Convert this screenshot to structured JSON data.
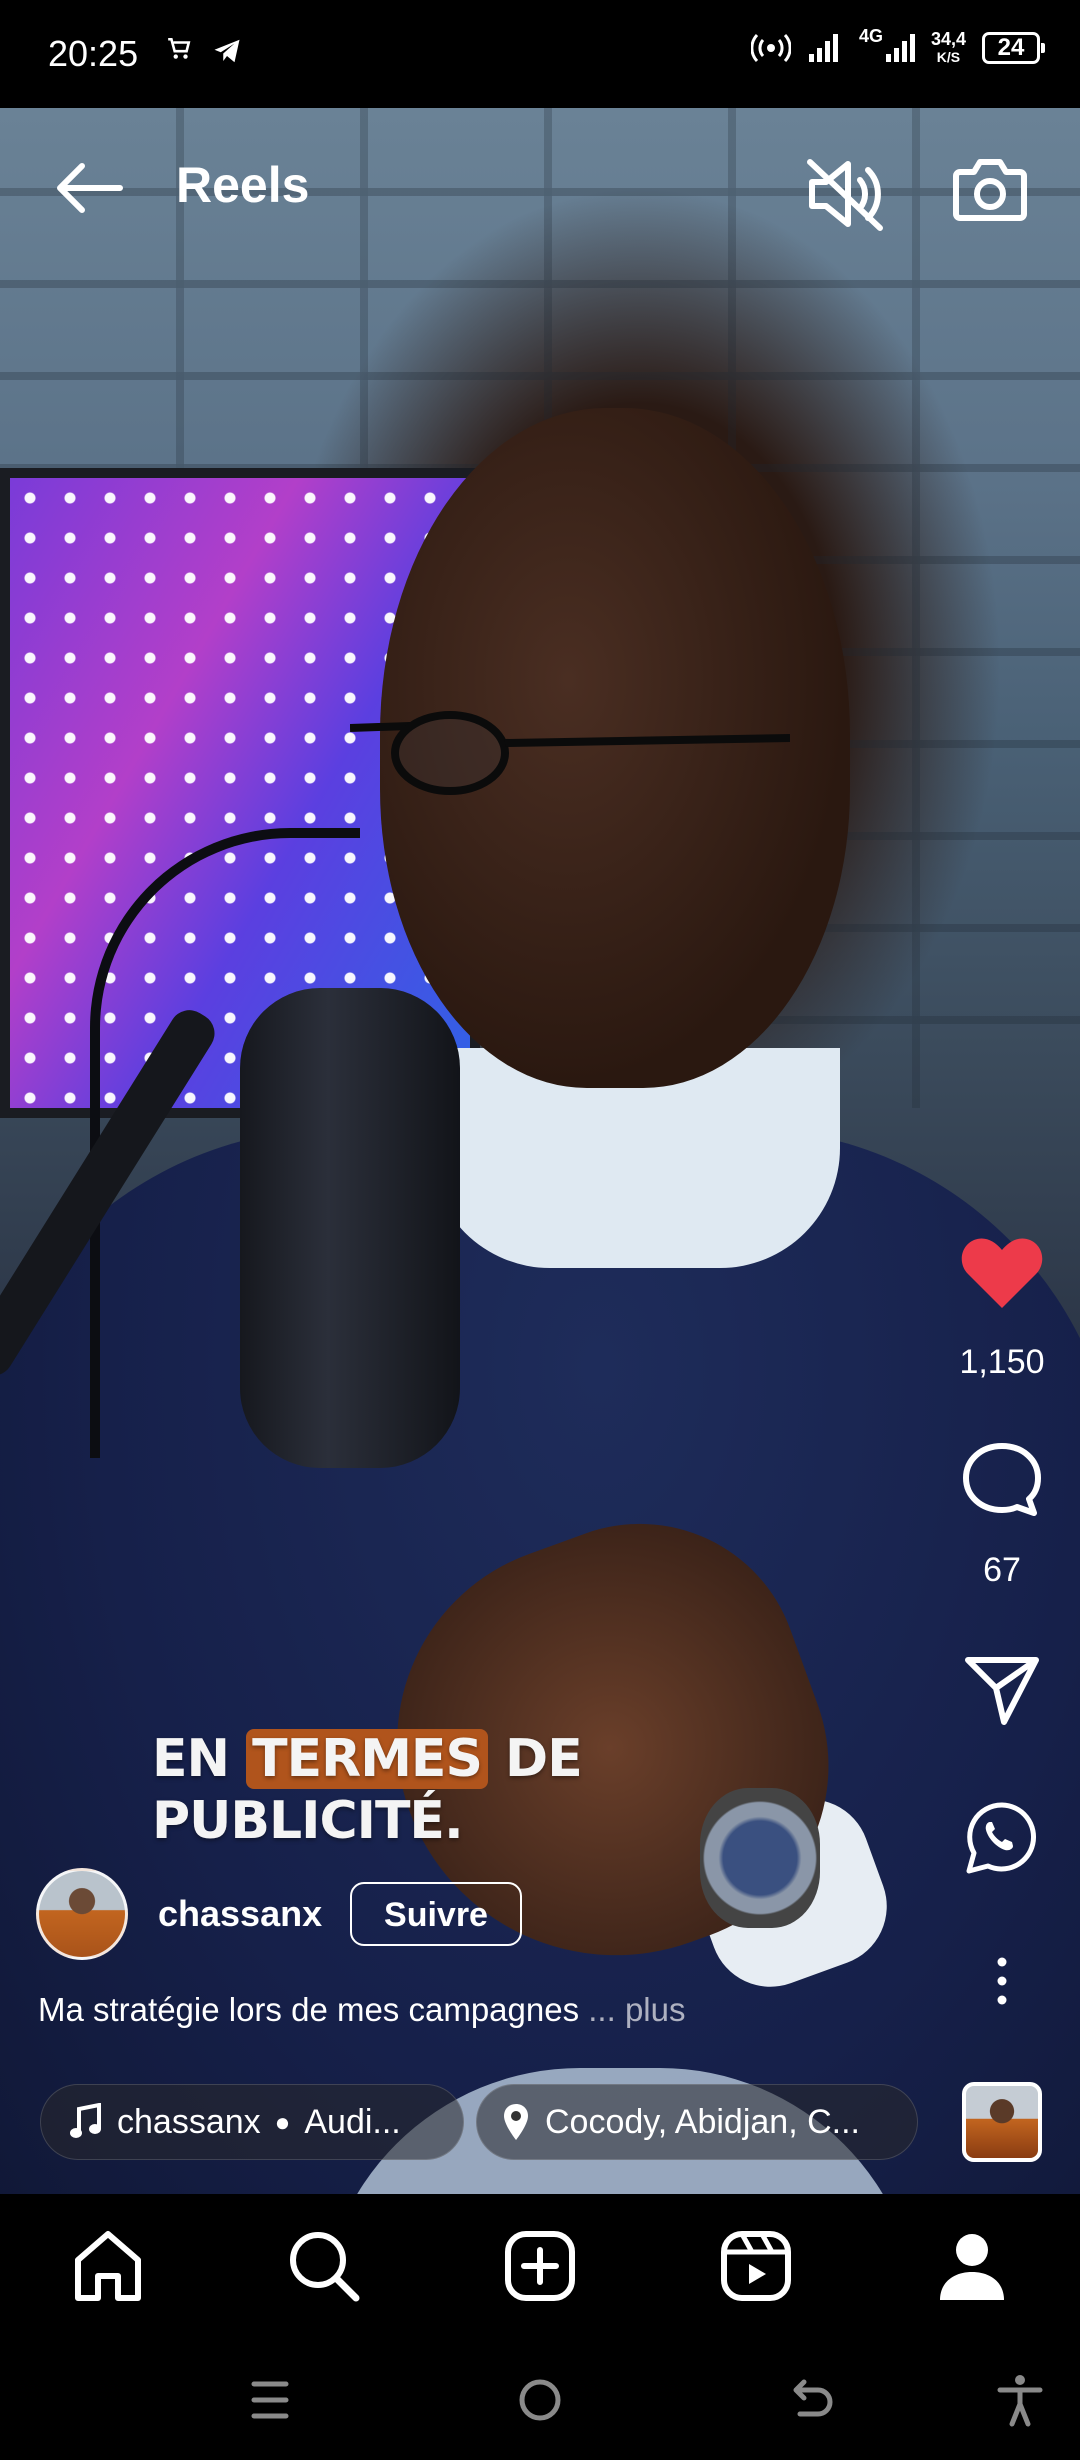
{
  "status_bar": {
    "time": "20:25",
    "network": "4G",
    "speed_value": "34,4",
    "speed_unit": "K/S",
    "battery": "24"
  },
  "header": {
    "title": "Reels"
  },
  "video": {
    "caption_line1_a": "EN ",
    "caption_line1_highlight": "TERMES",
    "caption_line1_b": " DE",
    "caption_line2": "PUBLICITÉ."
  },
  "actions": {
    "likes": "1,150",
    "comments": "67"
  },
  "post": {
    "username": "chassanx",
    "follow_label": "Suivre",
    "description": "Ma stratégie lors de mes campagnes",
    "more_label": "... plus",
    "music_artist": "chassanx",
    "music_title": "Audi...",
    "location": "Cocody, Abidjan, C..."
  },
  "colors": {
    "like_red": "#ED3A4A",
    "caption_highlight": "#B0541C"
  }
}
